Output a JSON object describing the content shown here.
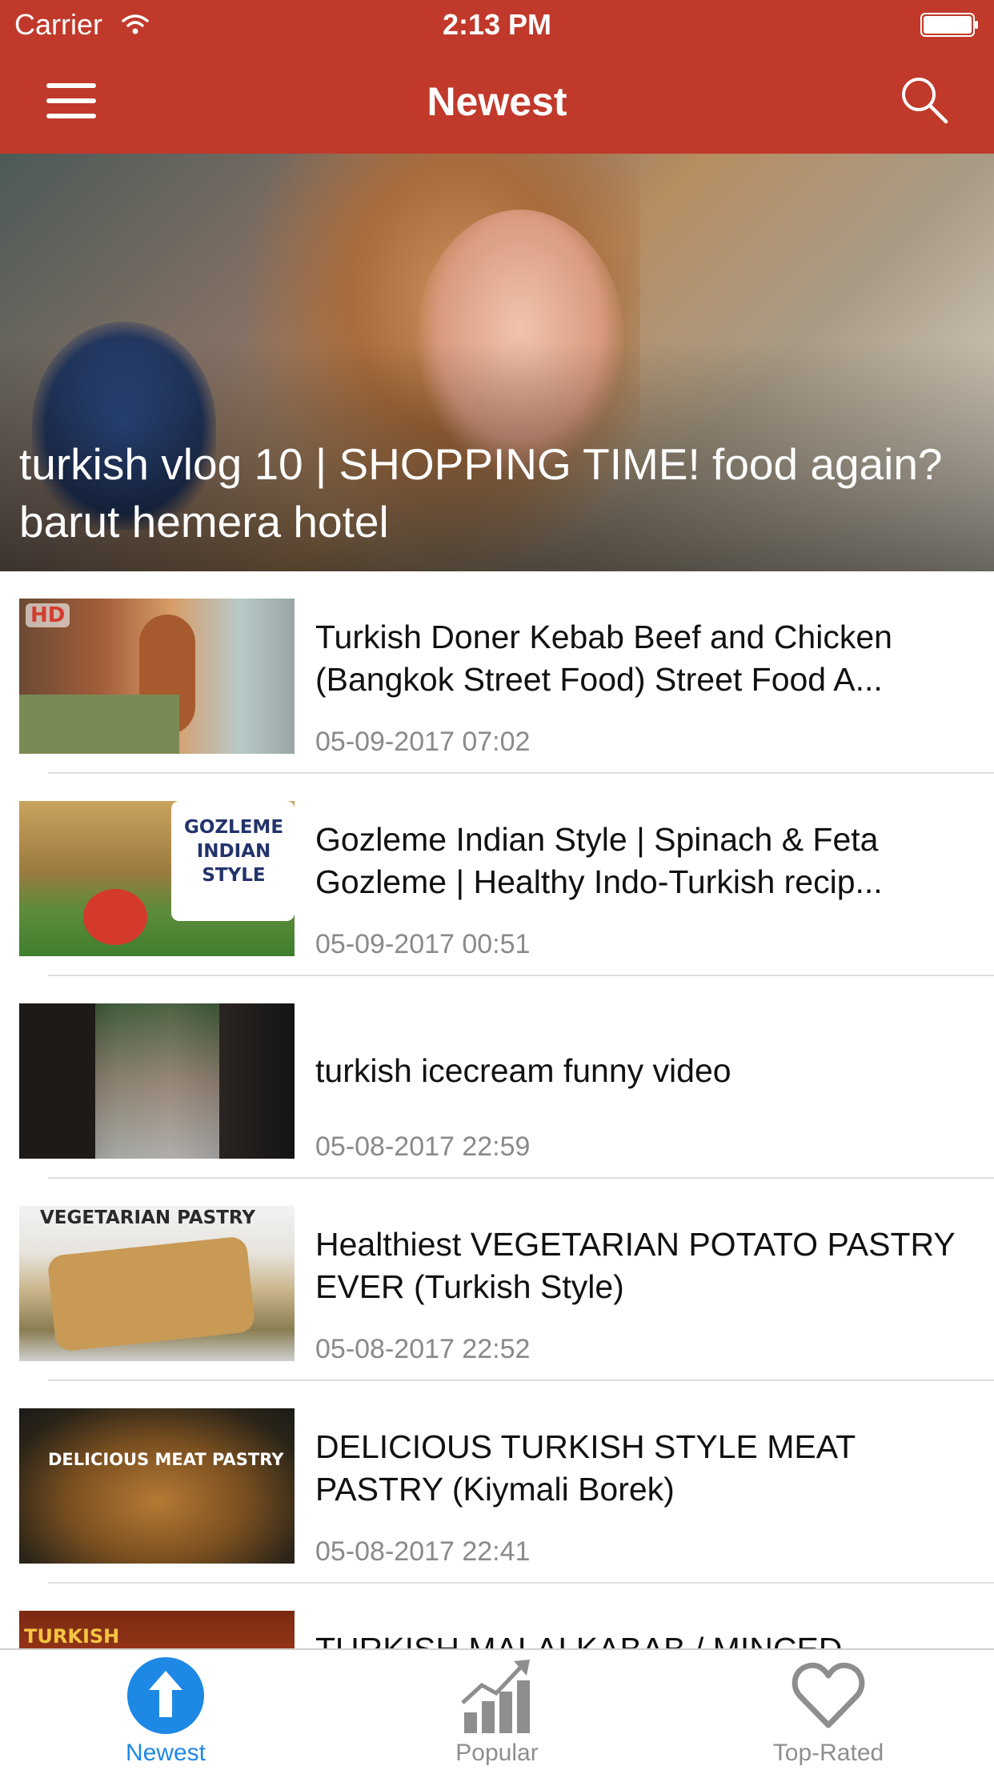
{
  "status_bar": {
    "carrier": "Carrier",
    "time": "2:13 PM"
  },
  "nav": {
    "title": "Newest",
    "menu_icon": "menu-icon",
    "search_icon": "search-icon"
  },
  "colors": {
    "brand": "#c0392b",
    "tab_active": "#1e88e5",
    "tab_inactive": "#8e8e8e"
  },
  "featured": {
    "title": "turkish vlog 10 | SHOPPING TIME! food again? barut hemera hotel"
  },
  "videos": [
    {
      "title": "Turkish Doner Kebab Beef and Chicken (Bangkok Street Food) Street Food A...",
      "date": "05-09-2017 07:02",
      "thumb_text": "HD"
    },
    {
      "title": "Gozleme Indian Style | Spinach & Feta Gozleme | Healthy Indo-Turkish recip...",
      "date": "05-09-2017 00:51",
      "thumb_text": "GOZLEME INDIAN STYLE"
    },
    {
      "title": "turkish icecream funny video",
      "date": "05-08-2017 22:59",
      "thumb_text": ""
    },
    {
      "title": "Healthiest VEGETARIAN POTATO PASTRY EVER (Turkish Style)",
      "date": "05-08-2017 22:52",
      "thumb_text": "VEGETARIAN PASTRY"
    },
    {
      "title": "DELICIOUS TURKISH STYLE MEAT PASTRY (Kiymali Borek)",
      "date": "05-08-2017 22:41",
      "thumb_text": "DELICIOUS MEAT PASTRY"
    },
    {
      "title": "TURKISH MALAI KABAB / MINCED",
      "date": "",
      "thumb_text": "TURKISH"
    }
  ],
  "tabs": [
    {
      "label": "Newest",
      "icon": "arrow-up-circle-icon",
      "active": true
    },
    {
      "label": "Popular",
      "icon": "bar-chart-trend-icon",
      "active": false
    },
    {
      "label": "Top-Rated",
      "icon": "heart-outline-icon",
      "active": false
    }
  ]
}
